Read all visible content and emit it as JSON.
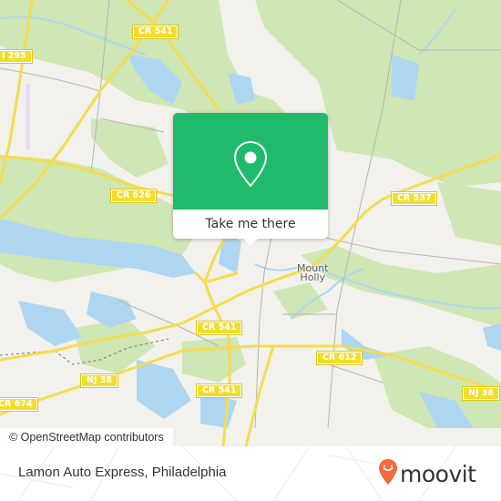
{
  "map": {
    "attribution": "© OpenStreetMap contributors",
    "colors": {
      "land": "#f2f1ec",
      "forest": "#cfe6b5",
      "water": "#aed6f0",
      "major_road": "#f3dd4f",
      "minor_road": "#b8b5b0",
      "shield": "#f3dd2b"
    },
    "road_labels": [
      {
        "id": "cr541-north",
        "text": "CR 541"
      },
      {
        "id": "i295",
        "text": "I 295"
      },
      {
        "id": "cr626",
        "text": "CR 626"
      },
      {
        "id": "cr537",
        "text": "CR 537"
      },
      {
        "id": "cr541-mid",
        "text": "CR 541"
      },
      {
        "id": "cr541-south",
        "text": "CR 541"
      },
      {
        "id": "nj38-west",
        "text": "NJ 38"
      },
      {
        "id": "cr674",
        "text": "CR 674"
      },
      {
        "id": "cr612",
        "text": "CR 612"
      },
      {
        "id": "nj38-east",
        "text": "NJ 38"
      }
    ],
    "place_labels": [
      {
        "id": "mount-holly",
        "line1": "Mount",
        "line2": "Holly"
      }
    ]
  },
  "popup": {
    "icon": "map-pin-icon",
    "button_label": "Take me there",
    "accent": "#1fba6b"
  },
  "footer": {
    "place_title": "Lamon Auto Express, Philadelphia",
    "brand": "moovit",
    "brand_color": "#f26a3d"
  }
}
